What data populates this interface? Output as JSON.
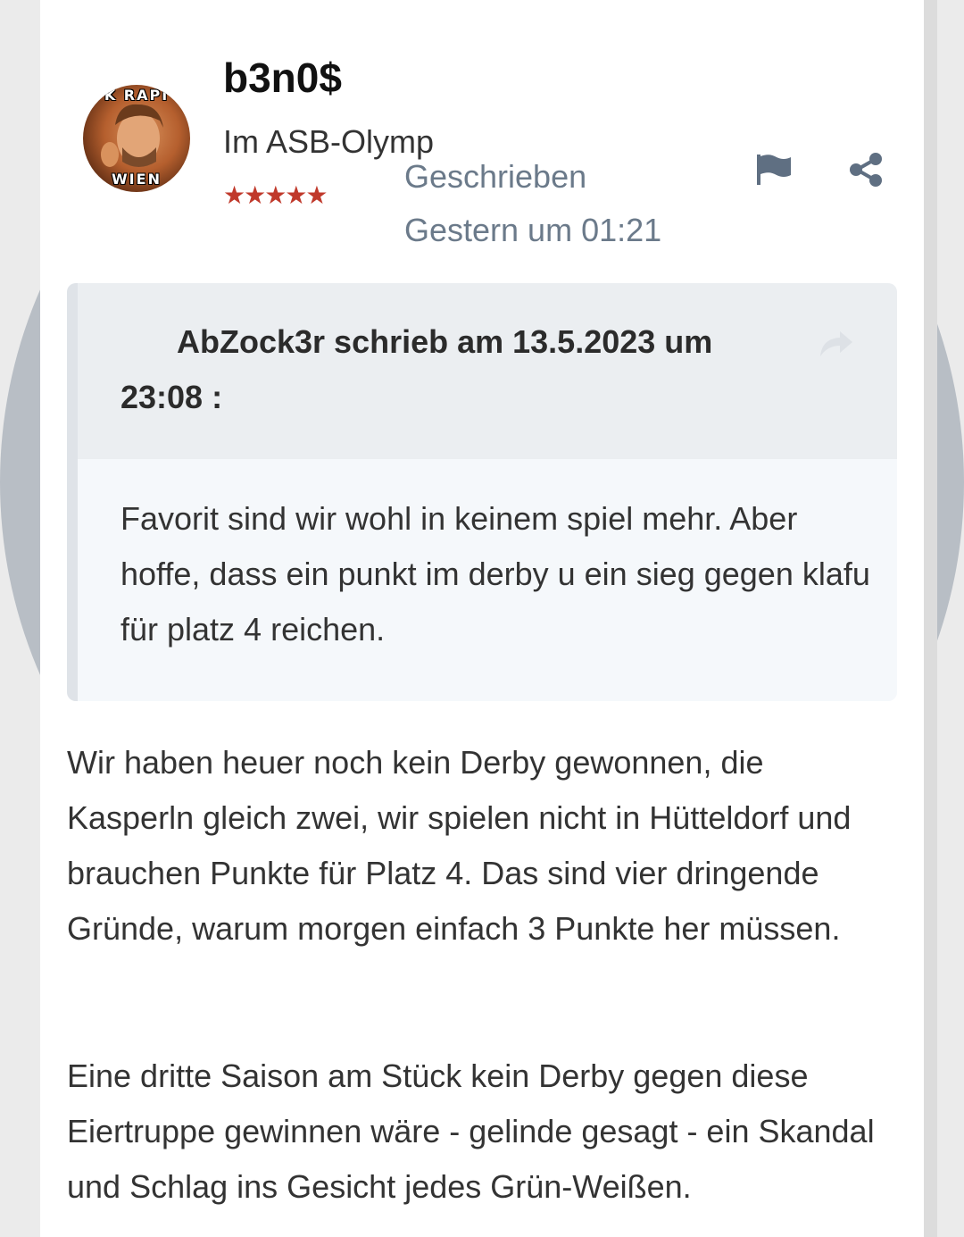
{
  "post": {
    "author": {
      "name": "b3n0$",
      "rank": "Im ASB-Olymp",
      "stars": "★★★★★",
      "avatar_caption_top": "K RAPI",
      "avatar_caption_bottom": "WIEN"
    },
    "meta": {
      "written_label": "Geschrieben",
      "date": "Gestern um 01:21"
    },
    "actions": {
      "flag_icon": "flag-icon",
      "share_icon": "share-icon"
    },
    "quote": {
      "citation": "AbZock3r schrieb am 13.5.2023 um 23:08 :",
      "text": "Favorit sind wir wohl in keinem spiel mehr. Aber hoffe, dass ein punkt im derby u ein sieg gegen klafu für platz 4 reichen."
    },
    "paragraphs": [
      "Wir haben heuer noch kein Derby gewonnen, die Kasperln gleich zwei, wir spielen nicht in Hütteldorf und brauchen Punkte für Platz 4. Das sind vier dringende Gründe, warum morgen einfach 3 Punkte her müssen.",
      "Eine dritte Saison am Stück kein Derby gegen diese Eiertruppe gewinnen wäre - gelinde gesagt - ein Skandal und Schlag ins Gesicht jedes Grün-Weißen."
    ]
  },
  "colors": {
    "meta": "#6b7a8a",
    "stars": "#c0392b",
    "quote_bg": "#f5f8fb",
    "quote_head_bg": "#ebeef1"
  }
}
